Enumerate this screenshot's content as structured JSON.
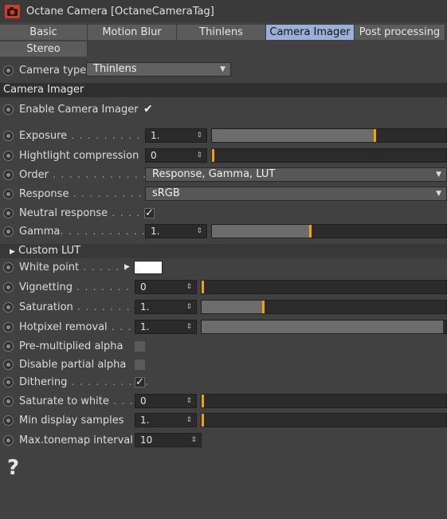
{
  "window": {
    "title": "Octane Camera [OctaneCameraTag]",
    "icon": "camera-icon"
  },
  "tabs": [
    {
      "label": "Basic",
      "active": false
    },
    {
      "label": "Motion Blur",
      "active": false
    },
    {
      "label": "Thinlens",
      "active": false
    },
    {
      "label": "Camera Imager",
      "active": true
    },
    {
      "label": "Post processing",
      "active": false
    },
    {
      "label": "Stereo",
      "active": false
    }
  ],
  "camera_type": {
    "label": "Camera type",
    "value": "Thinlens"
  },
  "section_camera_imager": "Camera Imager",
  "enable_imager": {
    "label": "Enable Camera Imager",
    "checked": true
  },
  "exposure": {
    "label": "Exposure",
    "dots": " . . . . . . . . . . .",
    "value": "1.",
    "level_fraction": 0.7
  },
  "highlight": {
    "label": "Hightlight compression",
    "value": "0",
    "level_fraction": 0.0
  },
  "order": {
    "label": "Order",
    "dots": " . . . . . . . . . . . . . .",
    "value": "Response, Gamma, LUT"
  },
  "response": {
    "label": "Response",
    "dots": " . . . . . . . . . . .",
    "value": "sRGB"
  },
  "neutral_response": {
    "label": "Neutral response",
    "dots": " . . . . .",
    "checked": true
  },
  "gamma": {
    "label": "Gamma",
    "dots": ". . . . . . . . . . . . .",
    "value": "1.",
    "level_fraction": 0.42
  },
  "custom_lut": {
    "label": "Custom LUT"
  },
  "white_point": {
    "label": "White point",
    "dots": " . . . . . .",
    "color": "#ffffff"
  },
  "vignetting": {
    "label": "Vignetting",
    "dots": " . . . . . . . . .",
    "value": "0",
    "level_fraction": 0.0
  },
  "saturation": {
    "label": "Saturation",
    "dots": " . . . . . . . . .",
    "value": "1.",
    "level_fraction": 0.25
  },
  "hotpixel": {
    "label": "Hotpixel removal",
    "dots": " . . . .",
    "value": "1.",
    "level_fraction": 1.0
  },
  "premultiplied": {
    "label": "Pre-multiplied alpha",
    "checked": false
  },
  "partial_alpha": {
    "label": "Disable partial alpha",
    "checked": false
  },
  "dithering": {
    "label": "Dithering",
    "dots": " . . . . . . . . . .",
    "checked": true
  },
  "saturate_white": {
    "label": "Saturate to white",
    "dots": " . . .",
    "value": "0",
    "level_fraction": 0.0
  },
  "min_samples": {
    "label": "Min display samples",
    "value": "1.",
    "level_fraction": 0.0
  },
  "max_tonemap": {
    "label": "Max.tonemap interval",
    "value": "10"
  },
  "help": {
    "glyph": "?"
  },
  "colors": {
    "accent": "#f0a500",
    "active_tab": "#9bb0d8",
    "background": "#414141"
  }
}
